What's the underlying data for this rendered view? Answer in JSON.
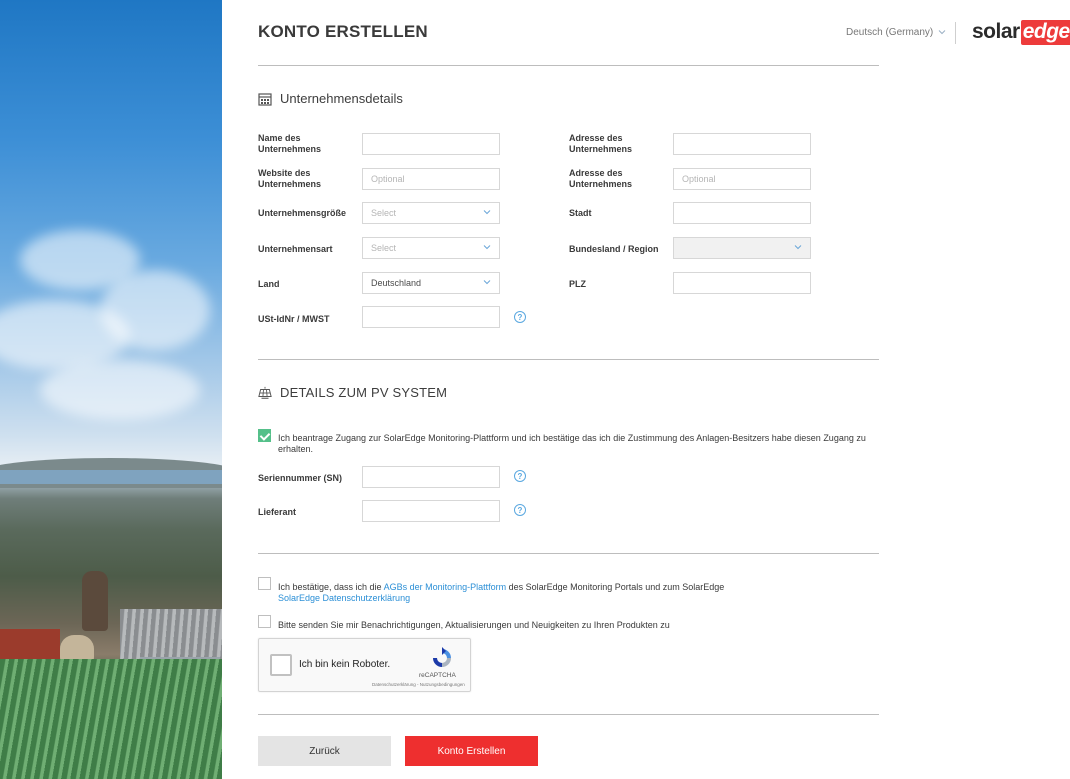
{
  "header": {
    "title": "KONTO ERSTELLEN",
    "language": "Deutsch (Germany)",
    "logo_solar": "solar",
    "logo_edge": "edge"
  },
  "company": {
    "section_title": "Unternehmensdetails",
    "fields": {
      "name_label": "Name des Unternehmens",
      "website_label": "Website des Unternehmens",
      "website_placeholder": "Optional",
      "size_label": "Unternehmensgröße",
      "size_value": "Select",
      "type_label": "Unternehmensart",
      "type_value": "Select",
      "country_label": "Land",
      "country_value": "Deutschland",
      "vat_label": "USt-IdNr / MWST",
      "address1_label": "Adresse des Unternehmens",
      "address2_label": "Adresse des Unternehmens",
      "address2_placeholder": "Optional",
      "city_label": "Stadt",
      "state_label": "Bundesland / Region",
      "zip_label": "PLZ"
    }
  },
  "pv": {
    "section_title": "DETAILS ZUM PV SYSTEM",
    "consent_text": "Ich beantrage Zugang zur SolarEdge Monitoring-Plattform und ich bestätige das ich die Zustimmung des Anlagen-Besitzers habe diesen Zugang zu erhalten.",
    "serial_label": "Seriennummer (SN)",
    "supplier_label": "Lieferant"
  },
  "terms": {
    "prefix": "Ich bestätige, dass ich die",
    "link1": "AGBs der Monitoring-Plattform",
    "middle": "des SolarEdge Monitoring Portals und zum SolarEdge",
    "link2": "SolarEdge Datenschutzerklärung",
    "newsletter": "Bitte senden Sie mir Benachrichtigungen, Aktualisierungen und Neuigkeiten zu Ihren Produkten zu"
  },
  "captcha": {
    "label": "Ich bin kein Roboter.",
    "brand": "reCAPTCHA",
    "privacy": "Datenschutzerklärung - Nutzungsbedingungen"
  },
  "buttons": {
    "back": "Zurück",
    "create": "Konto Erstellen"
  },
  "colors": {
    "accent": "#ee2f2f",
    "link": "#2b8fd6",
    "check": "#55c08a"
  }
}
